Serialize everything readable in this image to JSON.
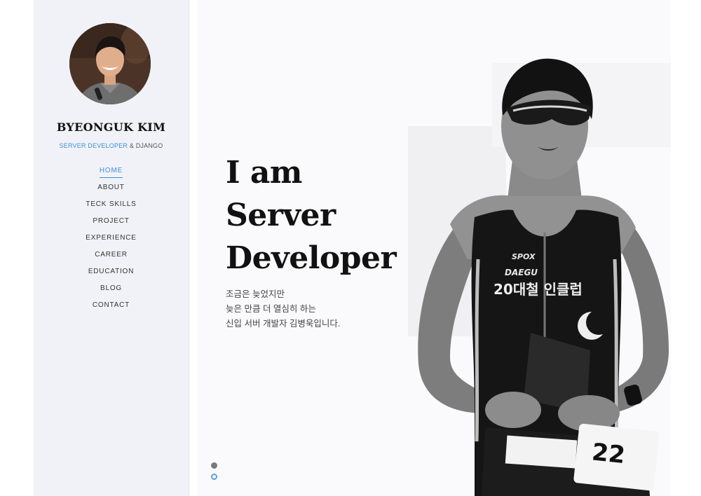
{
  "profile": {
    "name": "BYEONGUK KIM",
    "role": "SERVER DEVELOPER",
    "role_connector": " & ",
    "stack": "DJANGO"
  },
  "nav": {
    "items": [
      {
        "label": "HOME",
        "active": true
      },
      {
        "label": "ABOUT"
      },
      {
        "label": "TECK SKILLS"
      },
      {
        "label": "PROJECT"
      },
      {
        "label": "EXPERIENCE"
      },
      {
        "label": "CAREER"
      },
      {
        "label": "EDUCATION"
      },
      {
        "label": "BLOG"
      },
      {
        "label": "CONTACT"
      }
    ]
  },
  "hero": {
    "headline": [
      "I am",
      "Server",
      "Developer"
    ],
    "intro": [
      "조금은 늦었지만",
      "늦은 만큼 더 열심히 하는",
      "신입 서버 개발자 김병욱입니다."
    ],
    "jersey_text": {
      "brand": "SPOX",
      "city": "DAEGU",
      "club": "20대철 인클럽",
      "bib": "22"
    }
  },
  "carousel": {
    "slides": 2,
    "active_index": 0
  },
  "colors": {
    "accent": "#3f8fd6",
    "sidebar_bg": "#f1f2f8",
    "text_dark": "#111111"
  }
}
